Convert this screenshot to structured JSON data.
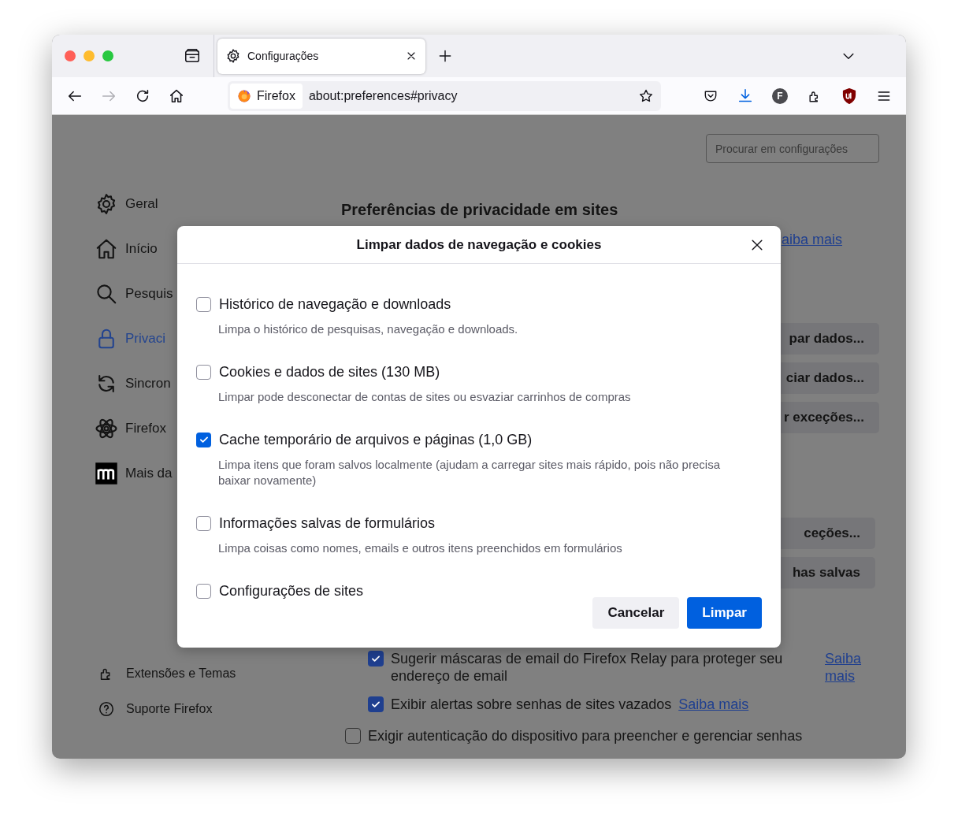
{
  "tabs": [
    {
      "label": "Configurações",
      "selected": true
    }
  ],
  "nav_buttons": [
    {
      "disabled": false
    },
    {
      "disabled": true
    },
    {
      "disabled": false
    },
    {
      "disabled": false
    }
  ],
  "address_bar": {
    "identity": "Firefox",
    "url": "about:preferences#privacy"
  },
  "account_initial": "F",
  "search": {
    "placeholder": "Procurar em configurações"
  },
  "sidebar": {
    "items": [
      {
        "label": "Geral",
        "selected": false
      },
      {
        "label": "Início",
        "selected": false
      },
      {
        "label": "Pesquis",
        "selected": false
      },
      {
        "label": "Privaci",
        "selected": true
      },
      {
        "label": "Sincron",
        "selected": false
      },
      {
        "label": "Firefox",
        "selected": false
      },
      {
        "label": "Mais da",
        "selected": false
      }
    ],
    "footer_items": [
      "Extensões e Temas",
      "Suporte Firefox"
    ]
  },
  "page": {
    "heading": "Preferências de privacidade em sites",
    "top_link": "aiba mais",
    "buttons": [
      "par dados...",
      "ciar dados...",
      "r exceções...",
      "ceções...",
      "has salvas"
    ],
    "sub_options": [
      {
        "label": "Sugerir máscaras de email do Firefox Relay para proteger seu endereço de email",
        "checked": true,
        "link": "Saiba mais",
        "kind": "aside"
      },
      {
        "label": "Exibir alertas sobre senhas de sites vazados",
        "checked": true,
        "link": "Saiba mais",
        "kind": "inline"
      }
    ],
    "options": [
      {
        "label": "Exigir autenticação do dispositivo para preencher e gerenciar senhas",
        "checked": false
      }
    ]
  },
  "dialog": {
    "title": "Limpar dados de navegação e cookies",
    "items": [
      {
        "label": "Histórico de navegação e downloads",
        "description": "Limpa o histórico de pesquisas, navegação e downloads.",
        "checked": false
      },
      {
        "label": "Cookies e dados de sites (130 MB)",
        "description": "Limpar pode desconectar de contas de sites ou esvaziar carrinhos de compras",
        "checked": false
      },
      {
        "label": "Cache temporário de arquivos e páginas (1,0 GB)",
        "description": "Limpa itens que foram salvos localmente (ajudam a carregar sites mais rápido, pois não precisa baixar novamente)",
        "checked": true
      },
      {
        "label": "Informações salvas de formulários",
        "description": "Limpa coisas como nomes, emails e outros itens preenchidos em formulários",
        "checked": false
      },
      {
        "label": "Configurações de sites",
        "checked": false
      }
    ],
    "buttons": [
      {
        "label": "Cancelar",
        "kind": "secondary"
      },
      {
        "label": "Limpar",
        "kind": "primary"
      }
    ]
  }
}
